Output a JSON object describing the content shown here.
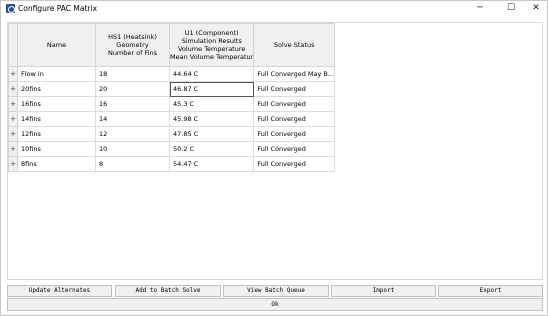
{
  "window": {
    "title": "Configure PAC Matrix",
    "minimize": "─",
    "maximize": "☐",
    "close": "✕"
  },
  "table": {
    "headers": {
      "name": "Name",
      "hs1": [
        "HS1 (Heatsink)",
        "Geometry",
        "Number of Fins"
      ],
      "u1": [
        "U1 (Component)",
        "Simulation Results",
        "Volume Temperature",
        "Mean Volume Temperatur"
      ],
      "status": "Solve Status"
    },
    "rows": [
      {
        "expander": "+",
        "name": "Flow in",
        "fins": "18",
        "temp": "44.64 C",
        "status": "Full Converged May B..."
      },
      {
        "expander": "+",
        "name": "20fins",
        "fins": "20",
        "temp": "46.87 C",
        "status": "Full Converged"
      },
      {
        "expander": "+",
        "name": "16fins",
        "fins": "16",
        "temp": "45.3 C",
        "status": "Full Converged"
      },
      {
        "expander": "+",
        "name": "14fins",
        "fins": "14",
        "temp": "45.98 C",
        "status": "Full Converged"
      },
      {
        "expander": "+",
        "name": "12fins",
        "fins": "12",
        "temp": "47.85 C",
        "status": "Full Converged"
      },
      {
        "expander": "+",
        "name": "10fins",
        "fins": "10",
        "temp": "50.2 C",
        "status": "Full Converged"
      },
      {
        "expander": "+",
        "name": "8fins",
        "fins": "8",
        "temp": "54.47 C",
        "status": "Full Converged"
      }
    ]
  },
  "buttons": {
    "update": "Update Alternates",
    "batch_solve": "Add to Batch Solve",
    "view_queue": "View Batch Queue",
    "import": "Import",
    "export": "Export",
    "ok": "Ok"
  }
}
